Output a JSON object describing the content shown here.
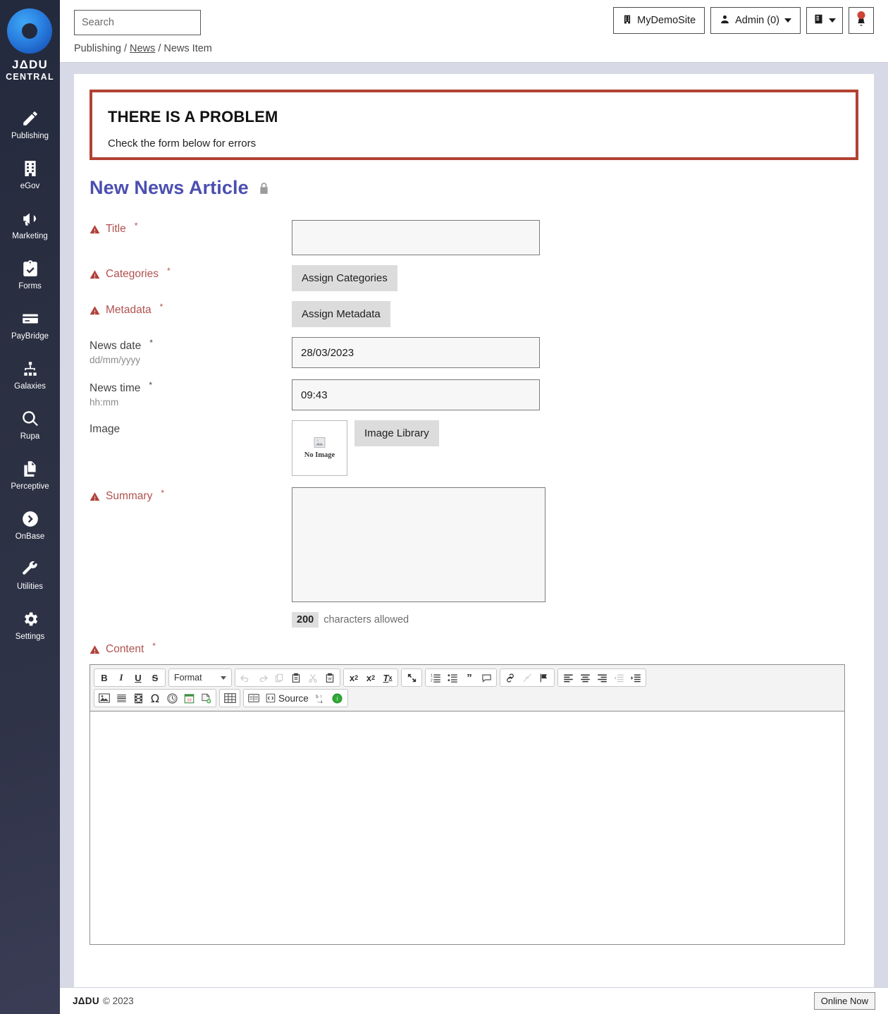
{
  "sidebar": {
    "logo": {
      "line1": "JΔDU",
      "line2": "CENTRAL"
    },
    "items": [
      {
        "label": "Publishing",
        "icon": "pencil-icon"
      },
      {
        "label": "eGov",
        "icon": "building-icon"
      },
      {
        "label": "Marketing",
        "icon": "megaphone-icon"
      },
      {
        "label": "Forms",
        "icon": "clipboard-check-icon"
      },
      {
        "label": "PayBridge",
        "icon": "credit-card-icon"
      },
      {
        "label": "Galaxies",
        "icon": "sitemap-icon"
      },
      {
        "label": "Rupa",
        "icon": "magnifier-icon"
      },
      {
        "label": "Perceptive",
        "icon": "documents-icon"
      },
      {
        "label": "OnBase",
        "icon": "arrow-circle-icon"
      },
      {
        "label": "Utilities",
        "icon": "wrench-icon"
      },
      {
        "label": "Settings",
        "icon": "gear-icon"
      }
    ]
  },
  "topbar": {
    "search_placeholder": "Search",
    "search_value": "",
    "search_icon": "search-icon",
    "site_button": {
      "label": "MyDemoSite",
      "icon": "building-icon"
    },
    "admin_button": {
      "label": "Admin (0)",
      "icon": "user-icon"
    },
    "book_button": {
      "label": "",
      "icon": "book-icon"
    },
    "bell_button": {
      "label": "",
      "icon": "bell-icon"
    }
  },
  "breadcrumb": {
    "root": "Publishing",
    "sep": "/",
    "link": "News",
    "current": "News Item"
  },
  "alert": {
    "title": "THERE IS A PROBLEM",
    "message": "Check the form below for errors",
    "border_color": "#b24233"
  },
  "page": {
    "title": "New News Article",
    "lock_icon": "lock-icon",
    "title_color": "#4b4fb0"
  },
  "form": {
    "title": {
      "label": "Title",
      "required": "*",
      "error": true,
      "value": ""
    },
    "categories": {
      "label": "Categories",
      "required": "*",
      "error": true,
      "button": "Assign Categories"
    },
    "metadata": {
      "label": "Metadata",
      "required": "*",
      "error": true,
      "button": "Assign Metadata"
    },
    "news_date": {
      "label": "News date",
      "required": "*",
      "hint": "dd/mm/yyyy",
      "value": "28/03/2023"
    },
    "news_time": {
      "label": "News time",
      "required": "*",
      "hint": "hh:mm",
      "value": "09:43"
    },
    "image": {
      "label": "Image",
      "no_image_text": "No Image",
      "button": "Image Library"
    },
    "summary": {
      "label": "Summary",
      "required": "*",
      "error": true,
      "value": "",
      "char_count": "200",
      "char_text": "characters allowed"
    },
    "content": {
      "label": "Content",
      "required": "*",
      "error": true,
      "value": ""
    }
  },
  "editor": {
    "format_label": "Format",
    "source_label": "Source",
    "row1": [
      {
        "name": "bold-icon",
        "glyph": "B",
        "group": 1,
        "disabled": false
      },
      {
        "name": "italic-icon",
        "glyph": "I",
        "group": 1,
        "disabled": false
      },
      {
        "name": "underline-icon",
        "glyph": "U",
        "group": 1,
        "disabled": false
      },
      {
        "name": "strikethrough-icon",
        "glyph": "S",
        "group": 1,
        "disabled": false
      },
      {
        "name": "undo-icon",
        "group": 3,
        "disabled": true
      },
      {
        "name": "redo-icon",
        "group": 3,
        "disabled": true
      },
      {
        "name": "copy-icon",
        "group": 3,
        "disabled": true
      },
      {
        "name": "paste-icon",
        "group": 3,
        "disabled": false
      },
      {
        "name": "cut-icon",
        "group": 3,
        "disabled": true
      },
      {
        "name": "paste-from-word-icon",
        "group": 3,
        "disabled": false
      },
      {
        "name": "subscript-icon",
        "group": 4,
        "disabled": false
      },
      {
        "name": "superscript-icon",
        "group": 4,
        "disabled": false
      },
      {
        "name": "remove-format-icon",
        "group": 4,
        "disabled": false
      },
      {
        "name": "maximize-icon",
        "group": 5,
        "disabled": false
      },
      {
        "name": "numbered-list-icon",
        "group": 6,
        "disabled": false
      },
      {
        "name": "bulleted-list-icon",
        "group": 6,
        "disabled": false
      },
      {
        "name": "blockquote-icon",
        "group": 6,
        "disabled": false
      },
      {
        "name": "comment-icon",
        "group": 6,
        "disabled": false
      },
      {
        "name": "link-icon",
        "group": 7,
        "disabled": false
      },
      {
        "name": "unlink-icon",
        "group": 7,
        "disabled": true
      },
      {
        "name": "anchor-flag-icon",
        "group": 7,
        "disabled": false
      },
      {
        "name": "align-left-icon",
        "group": 8,
        "disabled": false
      },
      {
        "name": "align-center-icon",
        "group": 8,
        "disabled": false
      },
      {
        "name": "align-right-icon",
        "group": 8,
        "disabled": false
      },
      {
        "name": "outdent-icon",
        "group": 8,
        "disabled": true
      },
      {
        "name": "indent-icon",
        "group": 8,
        "disabled": false
      }
    ],
    "row2": [
      {
        "name": "image-icon",
        "group": 1
      },
      {
        "name": "horizontal-rule-icon",
        "group": 1
      },
      {
        "name": "media-film-icon",
        "group": 1
      },
      {
        "name": "special-character-icon",
        "glyph": "Ω",
        "group": 1
      },
      {
        "name": "clock-icon",
        "group": 1
      },
      {
        "name": "calendar-icon",
        "group": 1
      },
      {
        "name": "page-break-icon",
        "group": 1
      },
      {
        "name": "table-icon",
        "group": 2
      },
      {
        "name": "read-more-icon",
        "group": 3
      },
      {
        "name": "source-icon",
        "group": 3
      },
      {
        "name": "spellcheck-icon",
        "group": 3
      },
      {
        "name": "info-icon",
        "group": 3
      }
    ]
  },
  "footer": {
    "logo": "JΔDU",
    "copyright": "© 2023",
    "online_button": "Online Now"
  }
}
